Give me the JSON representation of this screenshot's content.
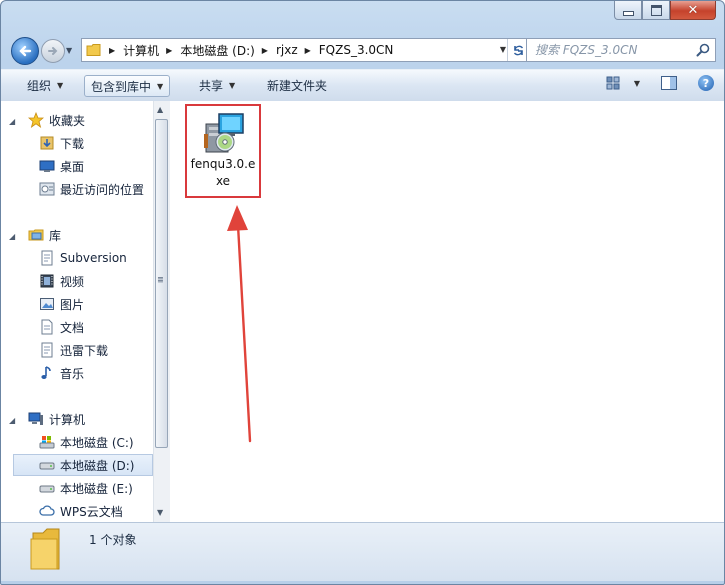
{
  "window": {
    "close_glyph": "✕"
  },
  "nav": {
    "back_icon": "back-arrow-icon",
    "breadcrumb": [
      "计算机",
      "本地磁盘 (D:)",
      "rjxz",
      "FQZS_3.0CN"
    ]
  },
  "search": {
    "placeholder": "搜索 FQZS_3.0CN"
  },
  "toolbar": {
    "organize": "组织",
    "include_library": "包含到库中",
    "share": "共享",
    "new_folder": "新建文件夹",
    "help_glyph": "?"
  },
  "sidebar": {
    "favorites": {
      "label": "收藏夹",
      "items": [
        "下载",
        "桌面",
        "最近访问的位置"
      ]
    },
    "libraries": {
      "label": "库",
      "items": [
        "Subversion",
        "视频",
        "图片",
        "文档",
        "迅雷下载",
        "音乐"
      ]
    },
    "computer": {
      "label": "计算机",
      "items": [
        "本地磁盘 (C:)",
        "本地磁盘 (D:)",
        "本地磁盘 (E:)",
        "WPS云文档"
      ],
      "selected": "本地磁盘 (D:)"
    }
  },
  "files": [
    {
      "name": "fenqu3.0.exe",
      "label_line1": "fenqu3.0.e",
      "label_line2": "xe",
      "icon": "installer-exe-icon"
    }
  ],
  "status": {
    "text": "1 个对象"
  },
  "colors": {
    "highlight_box": "#d9393c",
    "arrow": "#e0433a",
    "window_frame": "#c9ddf1"
  }
}
